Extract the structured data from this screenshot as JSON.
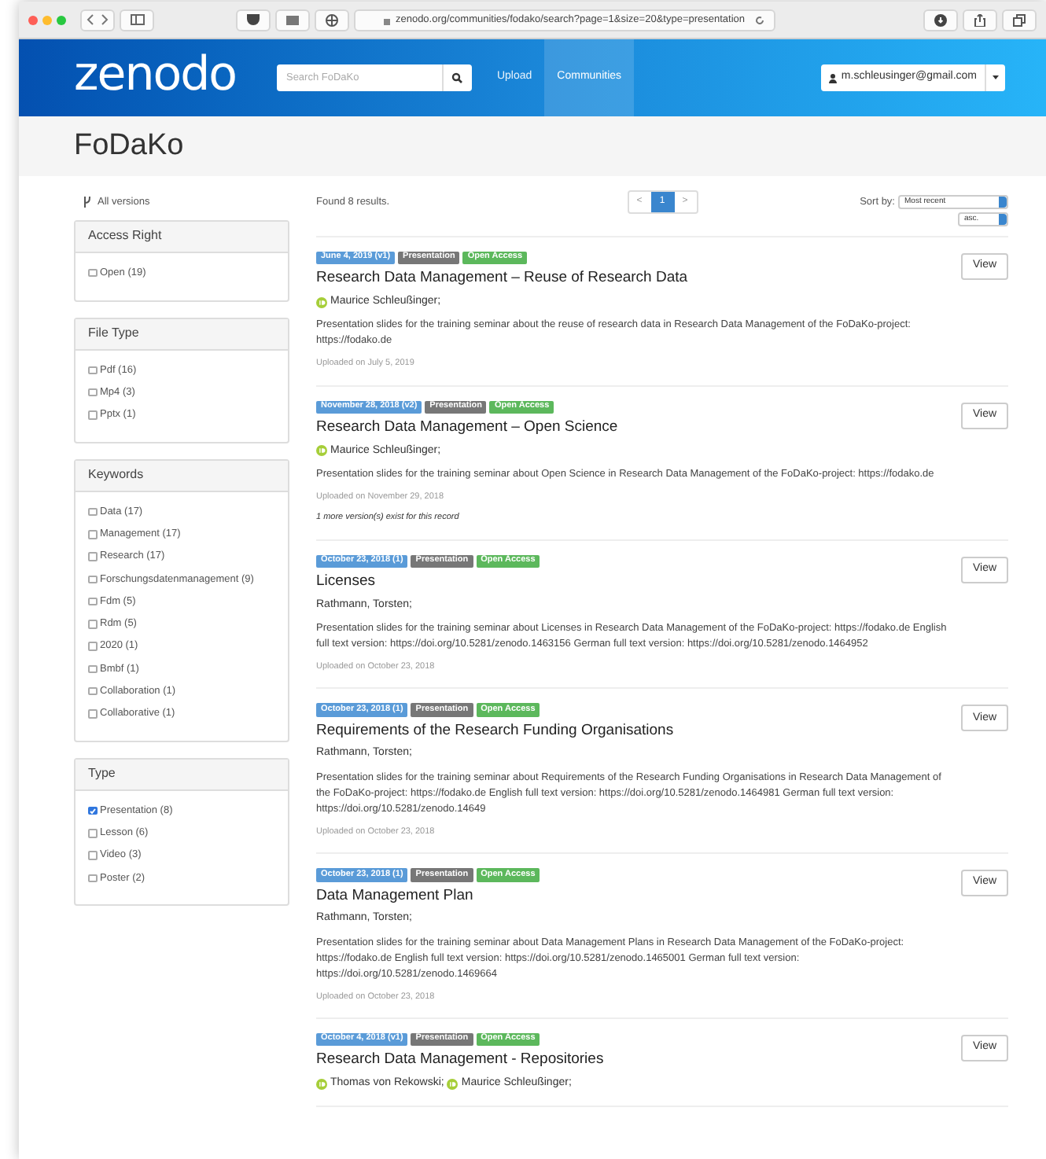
{
  "browser": {
    "url": "zenodo.org/communities/fodako/search?page=1&size=20&type=presentation"
  },
  "header": {
    "logo": "zenodo",
    "search_placeholder": "Search FoDaKo",
    "nav": [
      {
        "label": "Upload",
        "selected": false
      },
      {
        "label": "Communities",
        "selected": true
      }
    ],
    "user": "m.schleusinger@gmail.com"
  },
  "community_title": "FoDaKo",
  "sidebar": {
    "all_versions": "All versions",
    "facets": [
      {
        "title": "Access Right",
        "options": [
          {
            "label": "Open (19)",
            "checked": false
          }
        ]
      },
      {
        "title": "File Type",
        "options": [
          {
            "label": "Pdf (16)",
            "checked": false
          },
          {
            "label": "Mp4 (3)",
            "checked": false
          },
          {
            "label": "Pptx (1)",
            "checked": false
          }
        ]
      },
      {
        "title": "Keywords",
        "options": [
          {
            "label": "Data (17)",
            "checked": false
          },
          {
            "label": "Management (17)",
            "checked": false
          },
          {
            "label": "Research (17)",
            "checked": false
          },
          {
            "label": "Forschungsdatenmanagement (9)",
            "checked": false
          },
          {
            "label": "Fdm (5)",
            "checked": false
          },
          {
            "label": "Rdm (5)",
            "checked": false
          },
          {
            "label": "2020 (1)",
            "checked": false
          },
          {
            "label": "Bmbf (1)",
            "checked": false
          },
          {
            "label": "Collaboration (1)",
            "checked": false
          },
          {
            "label": "Collaborative (1)",
            "checked": false
          }
        ]
      },
      {
        "title": "Type",
        "options": [
          {
            "label": "Presentation (8)",
            "checked": true
          },
          {
            "label": "Lesson (6)",
            "checked": false
          },
          {
            "label": "Video (3)",
            "checked": false
          },
          {
            "label": "Poster (2)",
            "checked": false
          }
        ]
      }
    ]
  },
  "results": {
    "found": "Found 8 results.",
    "pagination": {
      "prev": "<",
      "pages": [
        {
          "label": "1",
          "selected": true
        }
      ],
      "next": ">"
    },
    "sort": {
      "label": "Sort by:",
      "value": "Most recent",
      "order": "asc."
    }
  },
  "records": [
    {
      "badges": [
        {
          "label": "June 4, 2019 (v1)",
          "kind": "version"
        },
        {
          "label": "Presentation",
          "kind": "type"
        },
        {
          "label": "Open Access",
          "kind": "access"
        }
      ],
      "title": "Research Data Management – Reuse of Research Data",
      "authors": [
        {
          "name": "Maurice Schleußinger;",
          "orcid": true
        }
      ],
      "description": "Presentation slides for the training seminar about the reuse of research data in Research Data Management of the FoDaKo-project: https://fodako.de",
      "uploaded": "Uploaded on July 5, 2019",
      "button": "View"
    },
    {
      "badges": [
        {
          "label": "November 28, 2018 (v2)",
          "kind": "version"
        },
        {
          "label": "Presentation",
          "kind": "type"
        },
        {
          "label": "Open Access",
          "kind": "access"
        }
      ],
      "title": "Research Data Management – Open Science",
      "authors": [
        {
          "name": "Maurice Schleußinger;",
          "orcid": true
        }
      ],
      "description": "Presentation slides for the training seminar about Open Science in Research Data Management of the FoDaKo-project: https://fodako.de",
      "uploaded": "Uploaded on November 29, 2018",
      "note": "1 more version(s) exist for this record",
      "button": "View"
    },
    {
      "badges": [
        {
          "label": "October 23, 2018 (1)",
          "kind": "version"
        },
        {
          "label": "Presentation",
          "kind": "type"
        },
        {
          "label": "Open Access",
          "kind": "access"
        }
      ],
      "title": "Licenses",
      "authors": [
        {
          "name": "Rathmann, Torsten;",
          "orcid": false
        }
      ],
      "description": "Presentation slides for the training seminar about Licenses in Research Data Management of the FoDaKo-project: https://fodako.de English full text version: https://doi.org/10.5281/zenodo.1463156 German full text version: https://doi.org/10.5281/zenodo.1464952",
      "uploaded": "Uploaded on October 23, 2018",
      "button": "View"
    },
    {
      "badges": [
        {
          "label": "October 23, 2018 (1)",
          "kind": "version"
        },
        {
          "label": "Presentation",
          "kind": "type"
        },
        {
          "label": "Open Access",
          "kind": "access"
        }
      ],
      "title": "Requirements of the Research Funding Organisations",
      "authors": [
        {
          "name": "Rathmann, Torsten;",
          "orcid": false
        }
      ],
      "description": "Presentation slides for the training seminar about Requirements of the Research Funding Organisations in Research Data Management of the FoDaKo-project: https://fodako.de English full text version: https://doi.org/10.5281/zenodo.1464981 German full text version: https://doi.org/10.5281/zenodo.14649",
      "uploaded": "Uploaded on October 23, 2018",
      "button": "View"
    },
    {
      "badges": [
        {
          "label": "October 23, 2018 (1)",
          "kind": "version"
        },
        {
          "label": "Presentation",
          "kind": "type"
        },
        {
          "label": "Open Access",
          "kind": "access"
        }
      ],
      "title": "Data Management Plan",
      "authors": [
        {
          "name": "Rathmann, Torsten;",
          "orcid": false
        }
      ],
      "description": "Presentation slides for the training seminar about Data Management Plans in Research Data Management of the FoDaKo-project: https://fodako.de English full text version: https://doi.org/10.5281/zenodo.1465001 German full text version: https://doi.org/10.5281/zenodo.1469664",
      "uploaded": "Uploaded on October 23, 2018",
      "button": "View"
    },
    {
      "badges": [
        {
          "label": "October 4, 2018 (v1)",
          "kind": "version"
        },
        {
          "label": "Presentation",
          "kind": "type"
        },
        {
          "label": "Open Access",
          "kind": "access"
        }
      ],
      "title": "Research Data Management - Repositories",
      "authors": [
        {
          "name": "Thomas von Rekowski;",
          "orcid": true
        },
        {
          "name": "Maurice Schleußinger;",
          "orcid": true
        }
      ],
      "button": "View"
    }
  ]
}
